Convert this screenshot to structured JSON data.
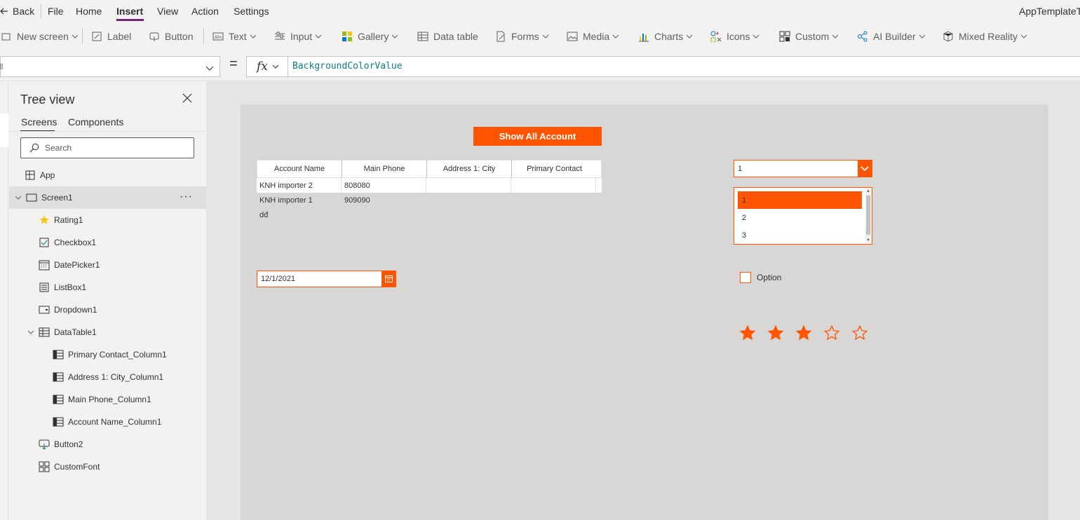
{
  "menu": {
    "back_label": "Back",
    "items": [
      "File",
      "Home",
      "Insert",
      "View",
      "Action",
      "Settings"
    ],
    "active": "Insert",
    "app_name": "AppTemplateT"
  },
  "ribbon": {
    "new_screen": "New screen",
    "label": "Label",
    "button": "Button",
    "text": "Text",
    "input": "Input",
    "gallery": "Gallery",
    "data_table": "Data table",
    "forms": "Forms",
    "media": "Media",
    "charts": "Charts",
    "icons": "Icons",
    "custom": "Custom",
    "ai_builder": "AI Builder",
    "mixed_reality": "Mixed Reality"
  },
  "formula_bar": {
    "property_value": "ll",
    "equals": "=",
    "fx_label": "fx",
    "formula": "BackgroundColorValue"
  },
  "tree_view": {
    "title": "Tree view",
    "tabs": [
      "Screens",
      "Components"
    ],
    "active_tab": "Screens",
    "search_placeholder": "Search",
    "app_label": "App",
    "screen_label": "Screen1",
    "more_label": "···",
    "controls": [
      {
        "label": "Rating1",
        "icon": "star-icon"
      },
      {
        "label": "Checkbox1",
        "icon": "checkbox-icon"
      },
      {
        "label": "DatePicker1",
        "icon": "calendar-icon"
      },
      {
        "label": "ListBox1",
        "icon": "listbox-icon"
      },
      {
        "label": "Dropdown1",
        "icon": "dropdown-icon"
      },
      {
        "label": "DataTable1",
        "icon": "table-icon"
      },
      {
        "label": "Primary Contact_Column1",
        "icon": "column-icon"
      },
      {
        "label": "Address 1: City_Column1",
        "icon": "column-icon"
      },
      {
        "label": "Main Phone_Column1",
        "icon": "column-icon"
      },
      {
        "label": "Account Name_Column1",
        "icon": "column-icon"
      },
      {
        "label": "Button2",
        "icon": "button-icon"
      },
      {
        "label": "CustomFont",
        "icon": "component-icon"
      }
    ]
  },
  "canvas": {
    "show_all_button": "Show All Account",
    "table": {
      "headers": [
        "Account Name",
        "Main Phone",
        "Address 1: City",
        "Primary Contact"
      ],
      "rows": [
        [
          "KNH importer 2",
          "808080",
          "",
          ""
        ],
        [
          "KNH importer 1",
          "909090",
          "",
          ""
        ],
        [
          "dđ",
          "",
          "",
          ""
        ]
      ]
    },
    "date_value": "12/1/2021",
    "dropdown_value": "1",
    "listbox_items": [
      "1",
      "2",
      "3"
    ],
    "listbox_selected": "1",
    "checkbox_label": "Option",
    "checkbox_checked": false,
    "rating_value": 3,
    "rating_max": 5
  },
  "colors": {
    "accent": "#ff5500",
    "canvas_bg": "#d9d6d6",
    "formula_text": "#0e7c86",
    "active_tab_underline": "#742774"
  }
}
